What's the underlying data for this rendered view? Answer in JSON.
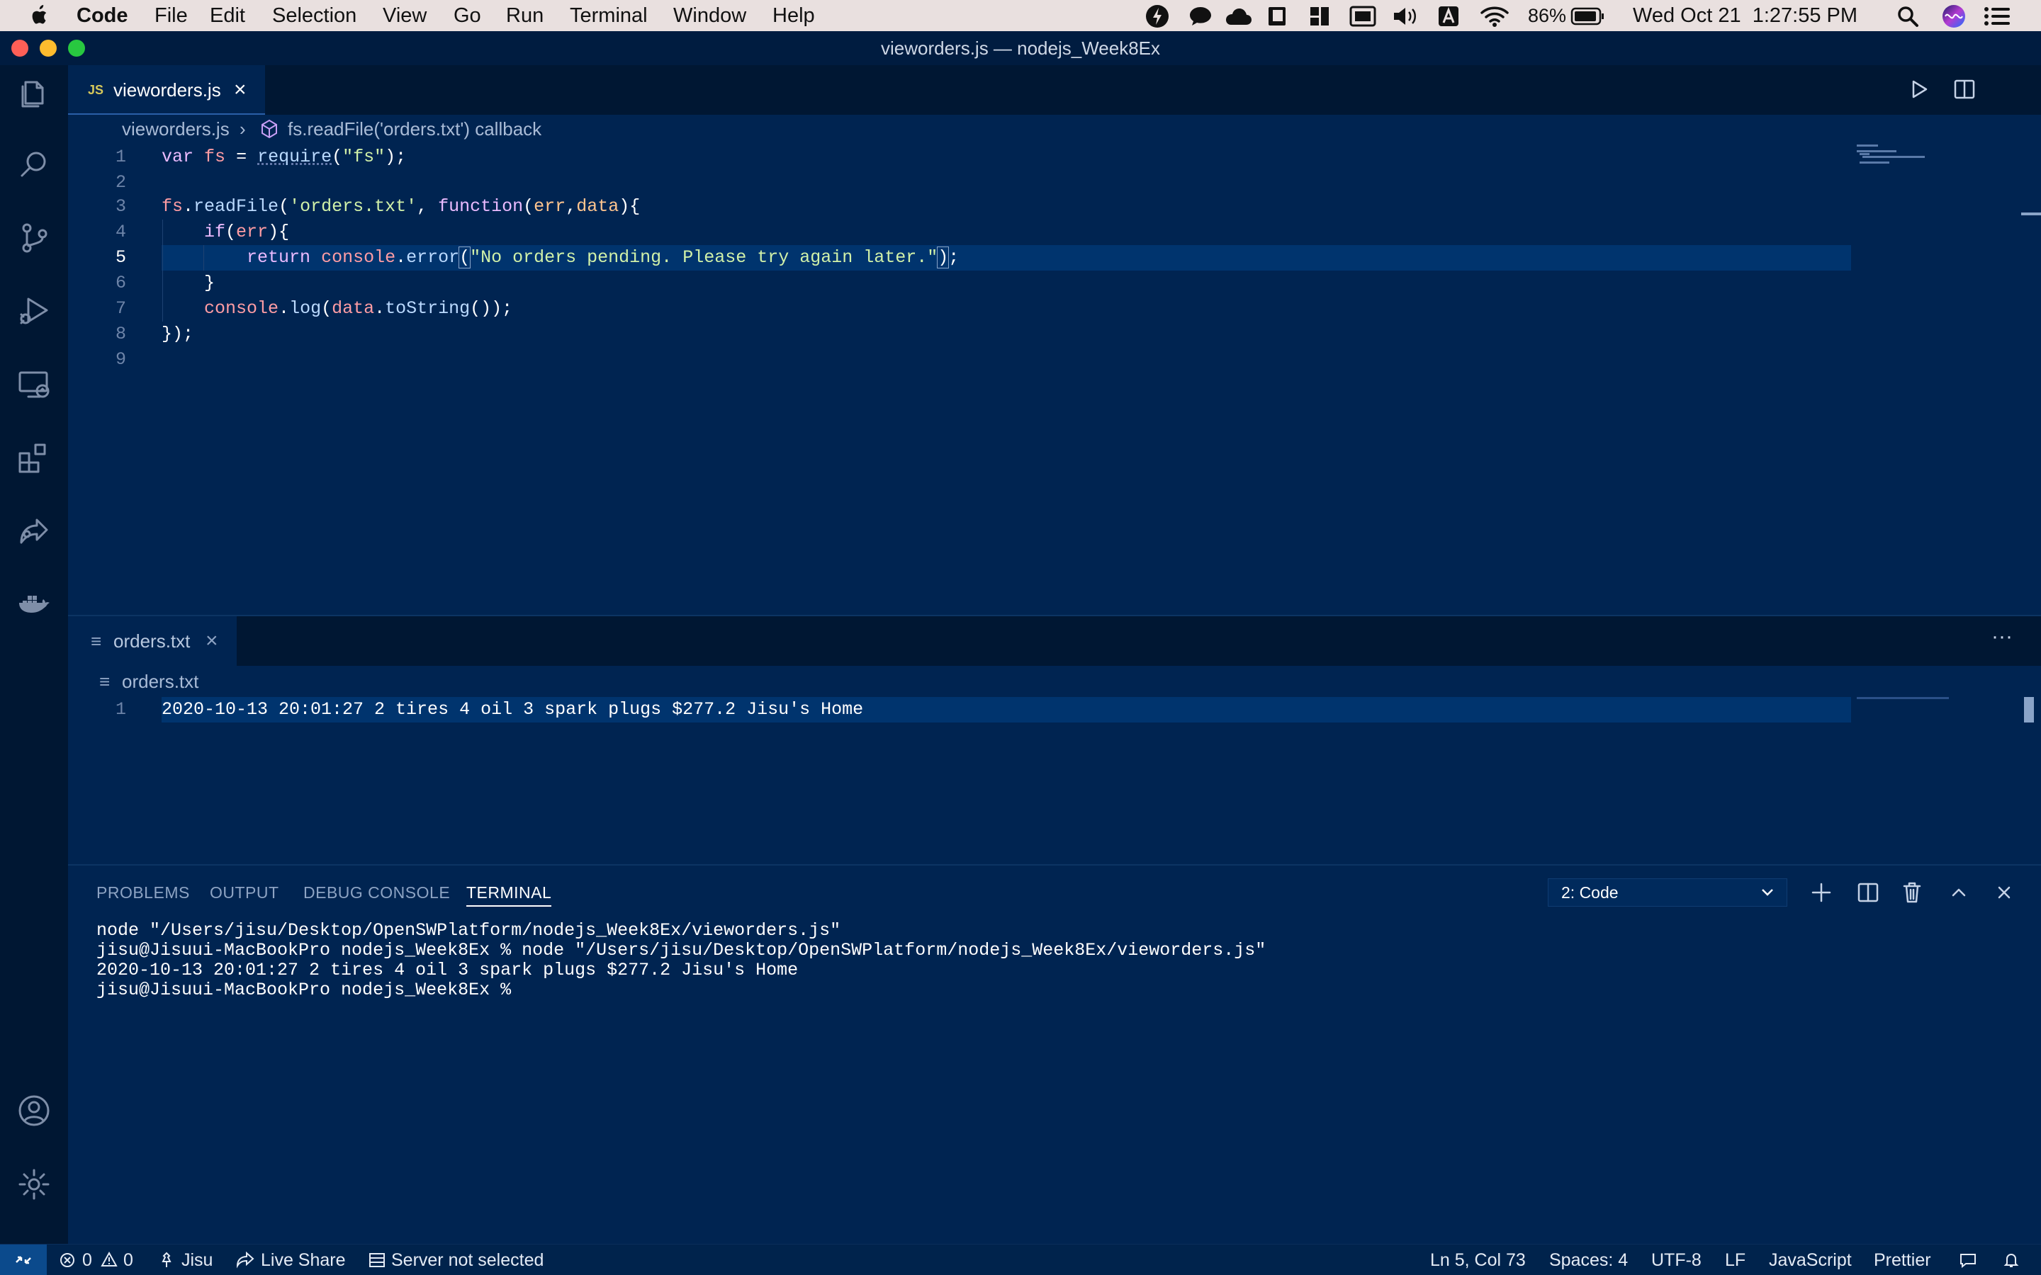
{
  "menubar": {
    "app_name": "Code",
    "items": [
      "File",
      "Edit",
      "Selection",
      "View",
      "Go",
      "Run",
      "Terminal",
      "Window",
      "Help"
    ],
    "battery": "86%",
    "clock": "Wed Oct 21  1:27:55 PM"
  },
  "window": {
    "title": "vieworders.js — nodejs_Week8Ex"
  },
  "editor1": {
    "tab": {
      "icon_label": "JS",
      "label": "vieworders.js"
    },
    "breadcrumb": {
      "file": "vieworders.js",
      "symbol": "fs.readFile('orders.txt') callback"
    },
    "line_numbers": [
      "1",
      "2",
      "3",
      "4",
      "5",
      "6",
      "7",
      "8",
      "9"
    ]
  },
  "editor2": {
    "tab": {
      "label": "orders.txt"
    },
    "breadcrumb": {
      "file": "orders.txt"
    },
    "line_numbers": [
      "1"
    ],
    "line1": "2020-10-13 20:01:27 2 tires 4 oil 3 spark plugs $277.2 Jisu's Home"
  },
  "panel": {
    "tabs": [
      "PROBLEMS",
      "OUTPUT",
      "DEBUG CONSOLE",
      "TERMINAL"
    ],
    "terminal_select": "2: Code",
    "terminal_lines": [
      "node \"/Users/jisu/Desktop/OpenSWPlatform/nodejs_Week8Ex/vieworders.js\"",
      "jisu@Jisuui-MacBookPro nodejs_Week8Ex % node \"/Users/jisu/Desktop/OpenSWPlatform/nodejs_Week8Ex/vieworders.js\"",
      "2020-10-13 20:01:27 2 tires 4 oil 3 spark plugs $277.2 Jisu's Home",
      "jisu@Jisuui-MacBookPro nodejs_Week8Ex % "
    ]
  },
  "status": {
    "errors": "0",
    "warnings": "0",
    "user": "Jisu",
    "live_share": "Live Share",
    "server": "Server not selected",
    "position": "Ln 5, Col 73",
    "spaces": "Spaces: 4",
    "encoding": "UTF-8",
    "eol": "LF",
    "language": "JavaScript",
    "formatter": "Prettier"
  },
  "colors": {
    "background": "#002451",
    "highlight": "#00346e",
    "status_bar": "#00234c"
  }
}
